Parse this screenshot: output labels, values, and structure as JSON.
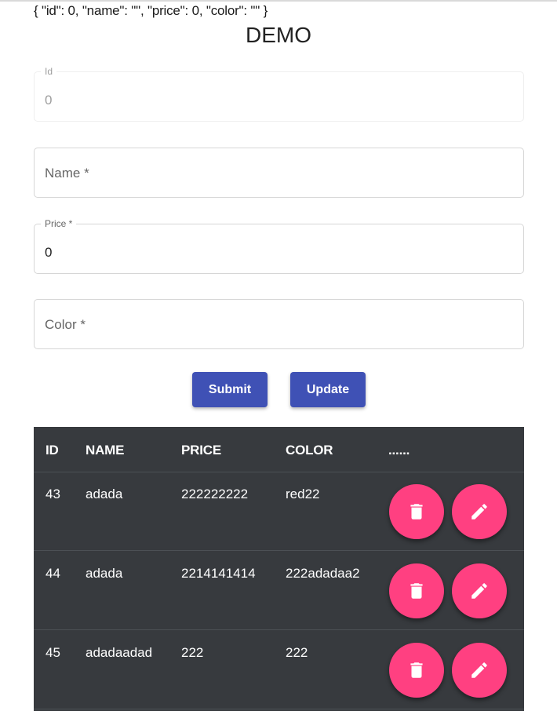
{
  "debug_json": "{ \"id\": 0, \"name\": \"\", \"price\": 0, \"color\": \"\" }",
  "title": "DEMO",
  "form": {
    "id": {
      "label": "Id",
      "value": "0"
    },
    "name": {
      "placeholder": "Name *"
    },
    "price": {
      "label": "Price *",
      "value": "0"
    },
    "color": {
      "placeholder": "Color *"
    }
  },
  "buttons": {
    "submit": "Submit",
    "update": "Update"
  },
  "table": {
    "headers": [
      "ID",
      "NAME",
      "PRICE",
      "COLOR",
      "......"
    ],
    "rows": [
      {
        "id": "43",
        "name": "adada",
        "price": "222222222",
        "color": "red22"
      },
      {
        "id": "44",
        "name": "adada",
        "price": "2214141414",
        "color": "222adadaa2"
      },
      {
        "id": "45",
        "name": "adadaadad",
        "price": "222",
        "color": "222"
      }
    ]
  },
  "icons": {
    "delete": "delete-icon",
    "edit": "pencil-icon"
  },
  "colors": {
    "primary": "#3f51b5",
    "accent": "#ff4081",
    "table_bg": "#373a3e"
  }
}
